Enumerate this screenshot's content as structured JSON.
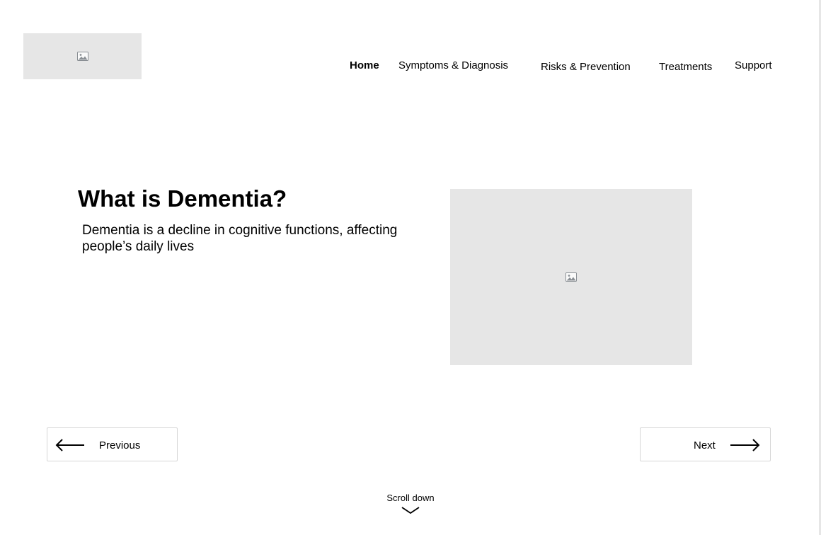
{
  "logo": {
    "icon": "image-placeholder-icon",
    "background": "#e6e6e6"
  },
  "nav": {
    "items": [
      {
        "label": "Home",
        "active": true
      },
      {
        "label": "Symptoms & Diagnosis",
        "active": false
      },
      {
        "label": "Risks & Prevention",
        "active": false
      },
      {
        "label": "Treatments",
        "active": false
      },
      {
        "label": "Support",
        "active": false
      }
    ]
  },
  "hero": {
    "title": "What is Dementia?",
    "description": "Dementia is a decline in cognitive functions, affecting people’s daily lives",
    "image_icon": "image-placeholder-icon"
  },
  "pagination": {
    "previous_label": "Previous",
    "previous_icon": "arrow-left-icon",
    "next_label": "Next",
    "next_icon": "arrow-right-icon"
  },
  "scroll": {
    "label": "Scroll down",
    "icon": "chevron-down-icon"
  },
  "colors": {
    "placeholder": "#e6e6e6",
    "text": "#000000",
    "button_border": "#d6d6d6"
  }
}
